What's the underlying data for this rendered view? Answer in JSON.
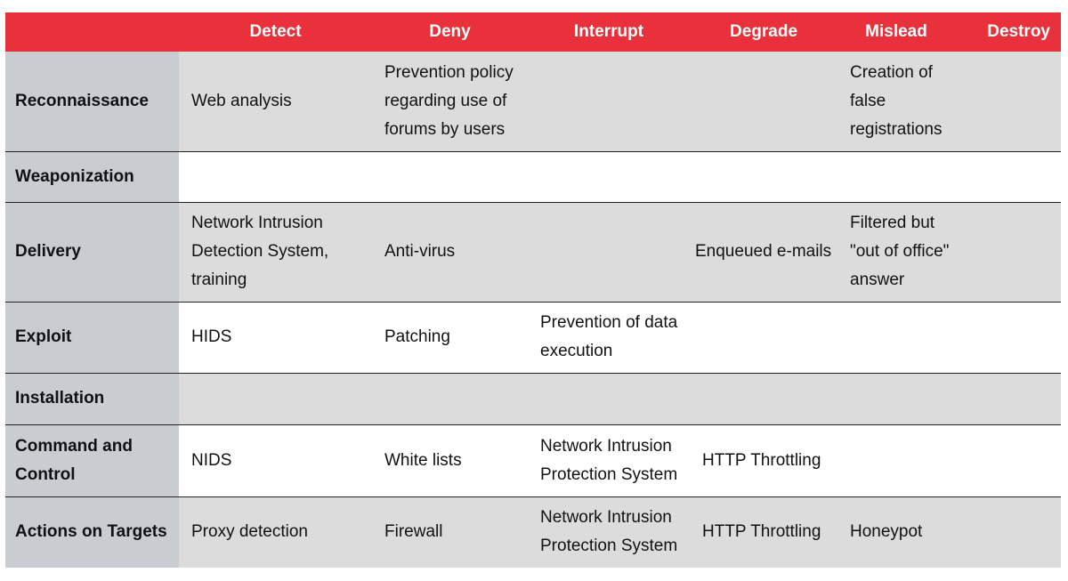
{
  "header": {
    "corner": "",
    "columns": [
      "Detect",
      "Deny",
      "Interrupt",
      "Degrade",
      "Mislead",
      "Destroy"
    ]
  },
  "rows": [
    {
      "phase": "Reconnaissance",
      "cells": [
        "Web analysis",
        "Prevention policy\nregarding use of\nforums by users",
        "",
        "",
        "Creation of\nfalse\nregistrations",
        ""
      ]
    },
    {
      "phase": "Weaponization",
      "cells": [
        "",
        "",
        "",
        "",
        "",
        ""
      ]
    },
    {
      "phase": "Delivery",
      "cells": [
        "Network Intrusion\nDetection System,\ntraining",
        "Anti-virus",
        "",
        "Enqueued e-mails",
        "Filtered but\n\"out of office\"\nanswer",
        ""
      ]
    },
    {
      "phase": "Exploit",
      "cells": [
        "HIDS",
        "Patching",
        "Prevention of data\nexecution",
        "",
        "",
        ""
      ]
    },
    {
      "phase": "Installation",
      "cells": [
        "",
        "",
        "",
        "",
        "",
        ""
      ]
    },
    {
      "phase": "Command and\nControl",
      "cells": [
        "NIDS",
        "White lists",
        "Network Intrusion\nProtection System",
        "HTTP Throttling",
        "",
        ""
      ]
    },
    {
      "phase": "Actions on Targets",
      "cells": [
        "Proxy detection",
        "Firewall",
        "Network Intrusion\nProtection System",
        "HTTP Throttling",
        "Honeypot",
        ""
      ]
    }
  ],
  "colors": {
    "header_bg": "#e8313a",
    "header_text": "#ffffff",
    "row_head_bg": "#c9ccd1",
    "shaded_row_bg": "#dcdcdc",
    "border": "#222222"
  }
}
